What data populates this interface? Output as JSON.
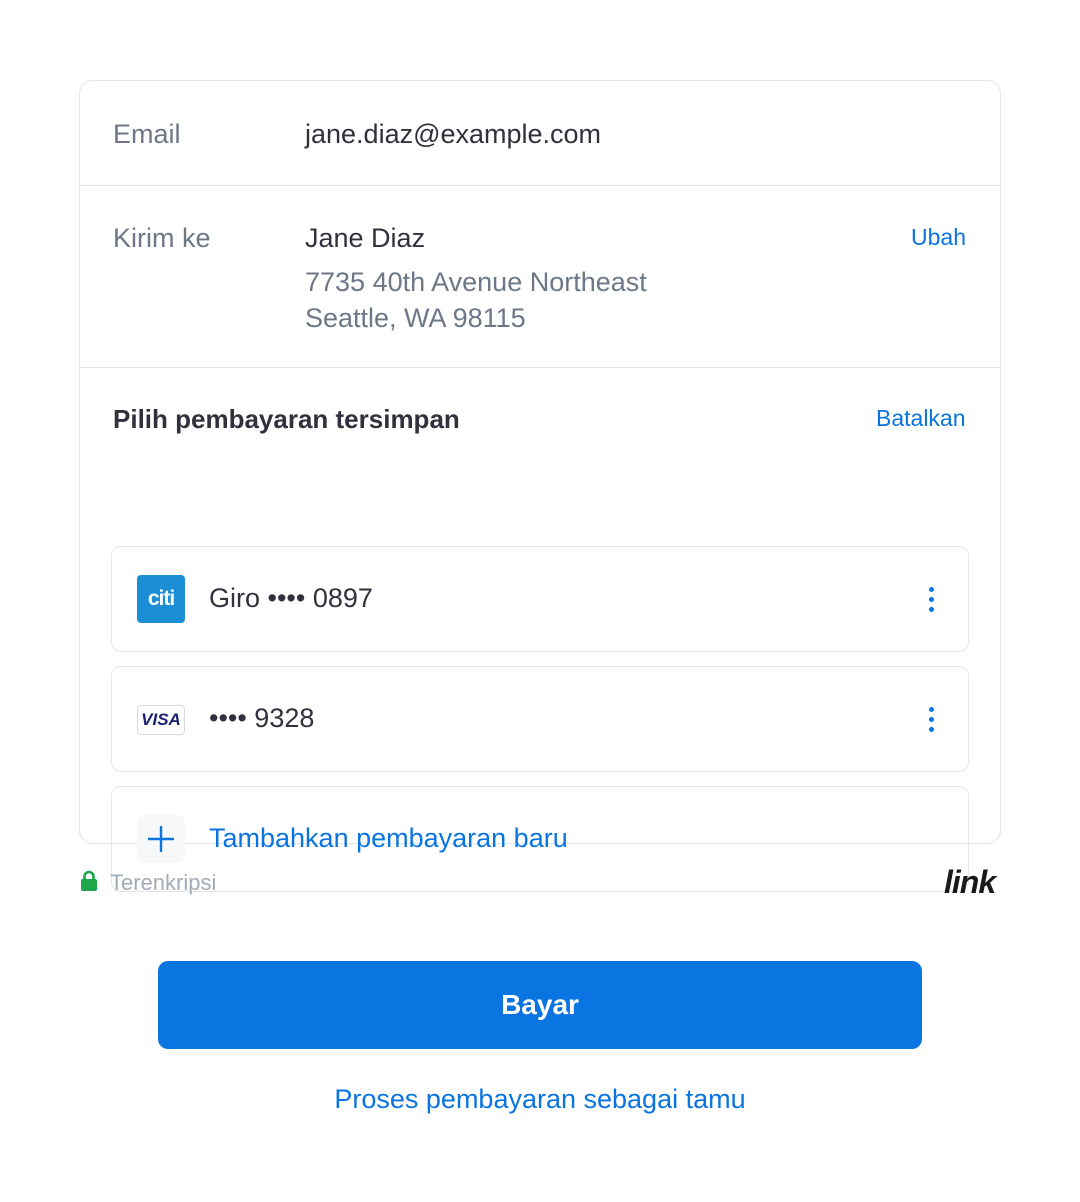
{
  "email": {
    "label": "Email",
    "value": "jane.diaz@example.com"
  },
  "shipping": {
    "label": "Kirim ke",
    "name": "Jane Diaz",
    "address_line1": "7735 40th Avenue Northeast",
    "address_line2": "Seattle, WA 98115",
    "change_label": "Ubah"
  },
  "payment": {
    "title": "Pilih pembayaran tersimpan",
    "cancel_label": "Batalkan",
    "methods": [
      {
        "icon": "citi-bank-logo",
        "logo_text": "citi",
        "label": "Giro •••• 0897"
      },
      {
        "icon": "visa-logo",
        "logo_text": "VISA",
        "label": "•••• 9328"
      }
    ],
    "add_new": {
      "icon": "plus-icon",
      "label": "Tambahkan pembayaran baru"
    }
  },
  "footer": {
    "encrypted_label": "Terenkripsi",
    "brand": "link"
  },
  "actions": {
    "pay_label": "Bayar",
    "guest_label": "Proses pembayaran sebagai tamu"
  },
  "colors": {
    "accent": "#0a74e0",
    "lock": "#1ea64a",
    "border": "#e3e6ea",
    "muted_text": "#6d7788"
  }
}
